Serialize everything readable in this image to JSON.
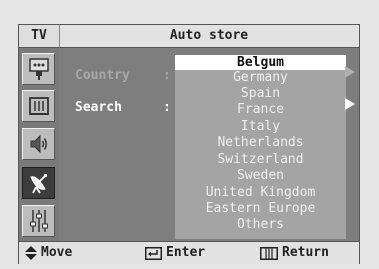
{
  "header": {
    "source_label": "TV",
    "title": "Auto store"
  },
  "sidebar": {
    "items": [
      {
        "icon": "tv-input-icon",
        "active": false
      },
      {
        "icon": "picture-icon",
        "active": false
      },
      {
        "icon": "speaker-icon",
        "active": false
      },
      {
        "icon": "satellite-dish-icon",
        "active": true
      },
      {
        "icon": "setup-sliders-icon",
        "active": false
      }
    ]
  },
  "menu": {
    "country": {
      "label": "Country",
      "separator": ":"
    },
    "search": {
      "label": "Search",
      "separator": ":"
    }
  },
  "country_list": {
    "options": [
      "Belgum",
      "Germany",
      "Spain",
      "France",
      "Italy",
      "Netherlands",
      "Switzerland",
      "Sweden",
      "United Kingdom",
      "Eastern Europe",
      "Others"
    ],
    "selected_index": 0
  },
  "footer": {
    "move": "Move",
    "enter": "Enter",
    "return": "Return"
  },
  "colors": {
    "panel": "#7e7e7e",
    "bar": "#e2e2e2",
    "list_bg": "#a4a4a4",
    "highlight": "#ffffff"
  }
}
